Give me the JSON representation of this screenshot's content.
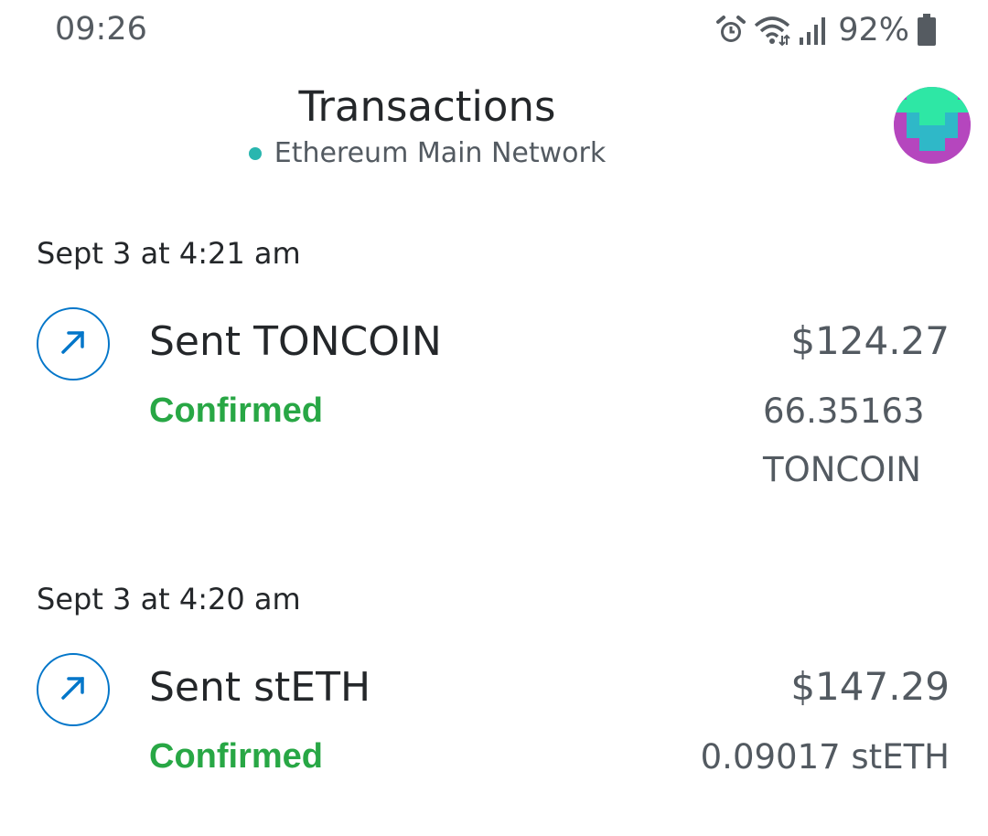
{
  "status_bar": {
    "time": "09:26",
    "battery": "92%",
    "icons": [
      "alarm-icon",
      "wifi-icon",
      "signal-icon",
      "battery-icon"
    ]
  },
  "header": {
    "title": "Transactions",
    "network": "Ethereum Main Network",
    "network_dot_color": "#29b6af"
  },
  "colors": {
    "accent": "#0376c9",
    "confirmed": "#28a745"
  },
  "transactions": [
    {
      "date": "Sept 3 at 4:21 am",
      "title": "Sent TONCOIN",
      "status": "Confirmed",
      "fiat": "$124.27",
      "amount": "66.35163 TONCOIN",
      "icon": "arrow-up-right-icon"
    },
    {
      "date": "Sept 3 at 4:20 am",
      "title": "Sent stETH",
      "status": "Confirmed",
      "fiat": "$147.29",
      "amount": "0.09017 stETH",
      "icon": "arrow-up-right-icon"
    }
  ]
}
